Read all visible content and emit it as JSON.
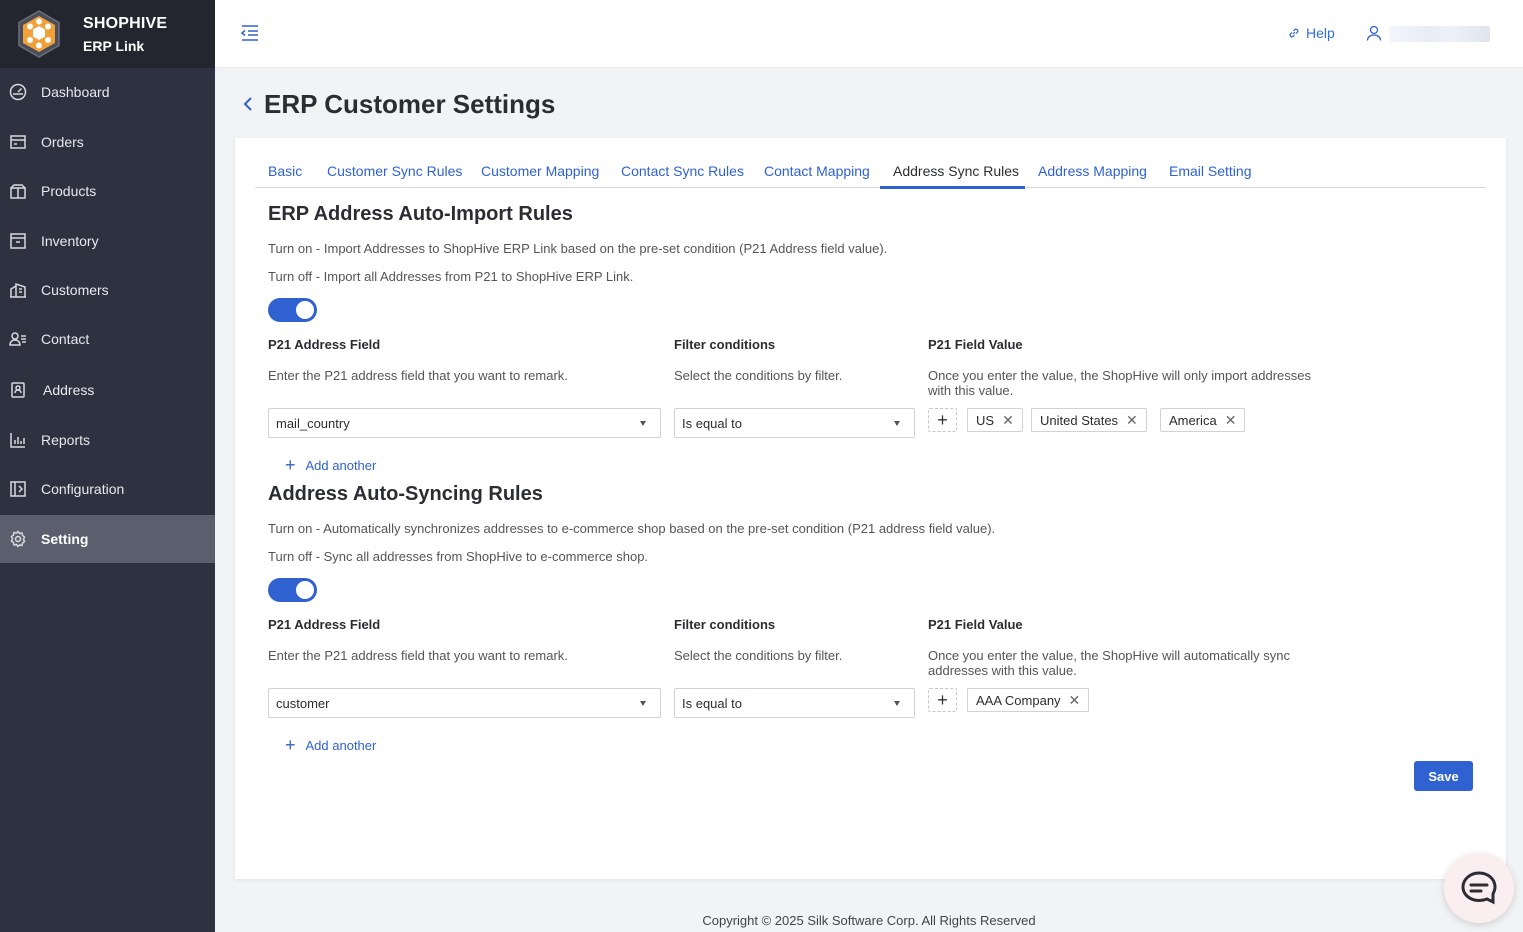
{
  "brand": {
    "name": "SHOPHIVE",
    "subtitle": "ERP Link"
  },
  "sidebar": {
    "items": [
      {
        "label": "Dashboard",
        "icon": "dashboard-icon"
      },
      {
        "label": "Orders",
        "icon": "orders-icon"
      },
      {
        "label": "Products",
        "icon": "products-icon"
      },
      {
        "label": "Inventory",
        "icon": "inventory-icon"
      },
      {
        "label": "Customers",
        "icon": "customers-icon"
      },
      {
        "label": "Contact",
        "icon": "contact-icon"
      },
      {
        "label": "Address",
        "icon": "address-icon"
      },
      {
        "label": "Reports",
        "icon": "reports-icon"
      },
      {
        "label": "Configuration",
        "icon": "configuration-icon"
      },
      {
        "label": "Setting",
        "icon": "setting-icon",
        "active": true
      }
    ]
  },
  "header": {
    "help_label": "Help"
  },
  "page": {
    "title": "ERP Customer Settings"
  },
  "tabs": [
    {
      "label": "Basic"
    },
    {
      "label": "Customer Sync Rules"
    },
    {
      "label": "Customer Mapping"
    },
    {
      "label": "Contact Sync Rules"
    },
    {
      "label": "Contact Mapping"
    },
    {
      "label": "Address Sync Rules",
      "active": true
    },
    {
      "label": "Address Mapping"
    },
    {
      "label": "Email Setting"
    }
  ],
  "import_rules": {
    "title": "ERP Address Auto-Import Rules",
    "turn_on": "Turn on - Import Addresses to ShopHive ERP Link based on the pre-set condition (P21 Address field value).",
    "turn_off": "Turn off - Import all Addresses from P21 to ShopHive ERP Link.",
    "enabled": true,
    "field_label": "P21 Address Field",
    "field_help": "Enter the P21 address field that you want to remark.",
    "filter_label": "Filter conditions",
    "filter_help": "Select the conditions by filter.",
    "value_label": "P21 Field Value",
    "value_help": "Once you enter the value, the ShopHive will only import addresses with this value.",
    "field_value": "mail_country",
    "filter_value": "Is equal to",
    "tags": [
      "US",
      "United States",
      "America"
    ],
    "add_another": "Add another"
  },
  "sync_rules": {
    "title": "Address Auto-Syncing Rules",
    "turn_on": "Turn on - Automatically synchronizes addresses to e-commerce shop based on the pre-set condition (P21 address field value).",
    "turn_off": "Turn off - Sync all addresses from ShopHive to e-commerce shop.",
    "enabled": true,
    "field_label": "P21 Address Field",
    "field_help": "Enter the P21 address field that you want to remark.",
    "filter_label": "Filter conditions",
    "filter_help": "Select the conditions by filter.",
    "value_label": "P21 Field Value",
    "value_help": "Once you enter the value, the ShopHive will automatically sync addresses with this value.",
    "field_value": "customer",
    "filter_value": "Is equal to",
    "tags": [
      "AAA Company"
    ],
    "add_another": "Add another"
  },
  "save_label": "Save",
  "footer": "Copyright © 2025 Silk Software Corp. All Rights Reserved",
  "colors": {
    "accent": "#2f62d0",
    "sidebar": "#2e3140",
    "sidebar_active": "#5b5e6c"
  }
}
